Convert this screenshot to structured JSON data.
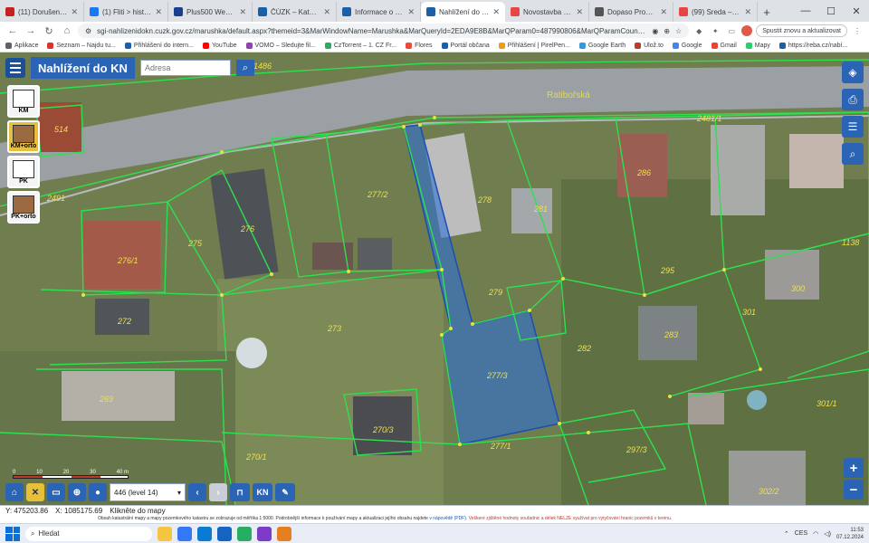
{
  "browser": {
    "tabs": [
      {
        "title": "(11) Dorušená – Sez...",
        "color": "#c5221f",
        "active": false
      },
      {
        "title": "(1) Fliti > historickýp...",
        "color": "#1877f2",
        "active": false
      },
      {
        "title": "Plus500 Webová plo...",
        "color": "#1a3f8f",
        "active": false
      },
      {
        "title": "ČÚZK – Katastrální m...",
        "color": "#1a5fa8",
        "active": false
      },
      {
        "title": "Informace o pozemku",
        "color": "#1a5fa8",
        "active": false
      },
      {
        "title": "Nahlížení do katastr...",
        "color": "#1a5fa8",
        "active": true
      },
      {
        "title": "Novostavba na prod...",
        "color": "#e84545",
        "active": false
      },
      {
        "title": "Dopaso Property – vi...",
        "color": "#555555",
        "active": false
      },
      {
        "title": "(99) Sreda – Lu...",
        "color": "#e84545",
        "active": false
      }
    ],
    "new_tab": "+",
    "url": "sgi-nahlizenidokn.cuzk.gov.cz/marushka/default.aspx?themeid=3&MarWindowName=Marushka&MarQueryId=2EDA9E8B&MarQParam0=487990806&MarQParamCount=1",
    "update_button": "Spustit znovu a aktualizovat",
    "bookmarks": [
      {
        "label": "Aplikace",
        "color": "#5f6368"
      },
      {
        "label": "Seznam – Najdu tu...",
        "color": "#d9342b"
      },
      {
        "label": "Přihlášení do intern...",
        "color": "#1a5fa8"
      },
      {
        "label": "YouTube",
        "color": "#ff0000"
      },
      {
        "label": "VOMO – Sledujte fil...",
        "color": "#8e44ad"
      },
      {
        "label": "CzTorrent – 1. CZ Fr...",
        "color": "#27ae60"
      },
      {
        "label": "Flores",
        "color": "#e74c3c"
      },
      {
        "label": "Portál občana",
        "color": "#1a5fa8"
      },
      {
        "label": "Přihlášení | PirelPen...",
        "color": "#f39c12"
      },
      {
        "label": "Google Earth",
        "color": "#3498db"
      },
      {
        "label": "Ulož.to",
        "color": "#c0392b"
      },
      {
        "label": "Google",
        "color": "#4285f4"
      },
      {
        "label": "Gmail",
        "color": "#ea4335"
      },
      {
        "label": "Mapy",
        "color": "#2ecc71"
      },
      {
        "label": "https://reba.cz/nabí...",
        "color": "#1a5fa8"
      }
    ]
  },
  "app": {
    "title": "Nahlížení do KN",
    "search_placeholder": "Adresa",
    "layers": [
      {
        "label": "KM",
        "selected": false
      },
      {
        "label": "KM+orto",
        "selected": true
      },
      {
        "label": "PK",
        "selected": false
      },
      {
        "label": "PK+orto",
        "selected": false
      }
    ],
    "street": "Ratibořská",
    "parcels": [
      {
        "label": "514"
      },
      {
        "label": "277/2"
      },
      {
        "label": "278"
      },
      {
        "label": "281"
      },
      {
        "label": "286"
      },
      {
        "label": "276"
      },
      {
        "label": "275"
      },
      {
        "label": "276/1"
      },
      {
        "label": "279"
      },
      {
        "label": "295"
      },
      {
        "label": "300"
      },
      {
        "label": "301"
      },
      {
        "label": "272"
      },
      {
        "label": "273"
      },
      {
        "label": "277/3"
      },
      {
        "label": "283"
      },
      {
        "label": "282"
      },
      {
        "label": "269"
      },
      {
        "label": "270/3"
      },
      {
        "label": "270/1"
      },
      {
        "label": "277/1"
      },
      {
        "label": "297/3"
      },
      {
        "label": "301/1"
      },
      {
        "label": "302/2"
      },
      {
        "label": "1138"
      },
      {
        "label": "2481/1"
      },
      {
        "label": "2491"
      },
      {
        "label": "1486"
      }
    ],
    "scale_ticks": [
      "0",
      "10",
      "20",
      "30",
      "40 m"
    ],
    "scale_select": "446 (level 14)",
    "tool_labels": {
      "kn": "KN"
    }
  },
  "status": {
    "y_coord": "Y: 475203.86",
    "x_coord": "X: 1085175.69",
    "hint": "Klikněte do mapy",
    "notice_text": "Obsah katastrální mapy a mapy pozemkového katastru se zobrazuje od měřítka 1:5000. Podrobnější informace k používání mapy a aktualizaci jejího obsahu najdete",
    "notice_link": "v nápovědě (PDF)",
    "notice_warn": "Veškeré zjištěné hodnoty souřadnic a délek NELZE využívat pro vytyčování hranic pozemků v terénu."
  },
  "taskbar": {
    "search": "Hledat",
    "lang": "CES",
    "time": "11:53",
    "date": "07.12.2024"
  }
}
